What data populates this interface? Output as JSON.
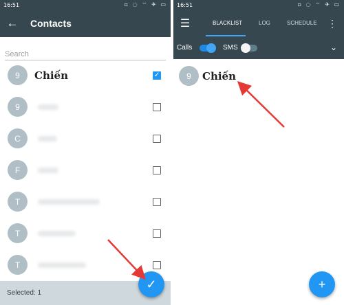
{
  "left": {
    "status_time": "16:51",
    "status_icons": "▫ ◌ ⌔ ✈ ▭",
    "title": "Contacts",
    "search_placeholder": "Search",
    "contacts": [
      {
        "avatar": "9",
        "name": "Chiến",
        "checked": true
      },
      {
        "avatar": "9",
        "name": "",
        "checked": false
      },
      {
        "avatar": "C",
        "name": "",
        "checked": false
      },
      {
        "avatar": "F",
        "name": "",
        "checked": false
      },
      {
        "avatar": "T",
        "name": "",
        "checked": false
      },
      {
        "avatar": "T",
        "name": "",
        "checked": false
      },
      {
        "avatar": "T",
        "name": "",
        "checked": false
      }
    ],
    "selected_text": "Selected: 1",
    "fab_icon": "check-icon"
  },
  "right": {
    "status_time": "16:51",
    "status_icons": "▫ ◌ ⌔ ✈ ▭",
    "tabs": [
      "BLACKLIST",
      "LOG",
      "SCHEDULE"
    ],
    "calls_label": "Calls",
    "sms_label": "SMS",
    "calls_on": true,
    "sms_on": false,
    "entry_avatar": "9",
    "entry_name": "Chiến",
    "fab_icon": "plus-icon"
  },
  "colors": {
    "appbar": "#37474f",
    "accent": "#2196f3",
    "avatar": "#b0bec5",
    "arrow": "#e53935"
  }
}
